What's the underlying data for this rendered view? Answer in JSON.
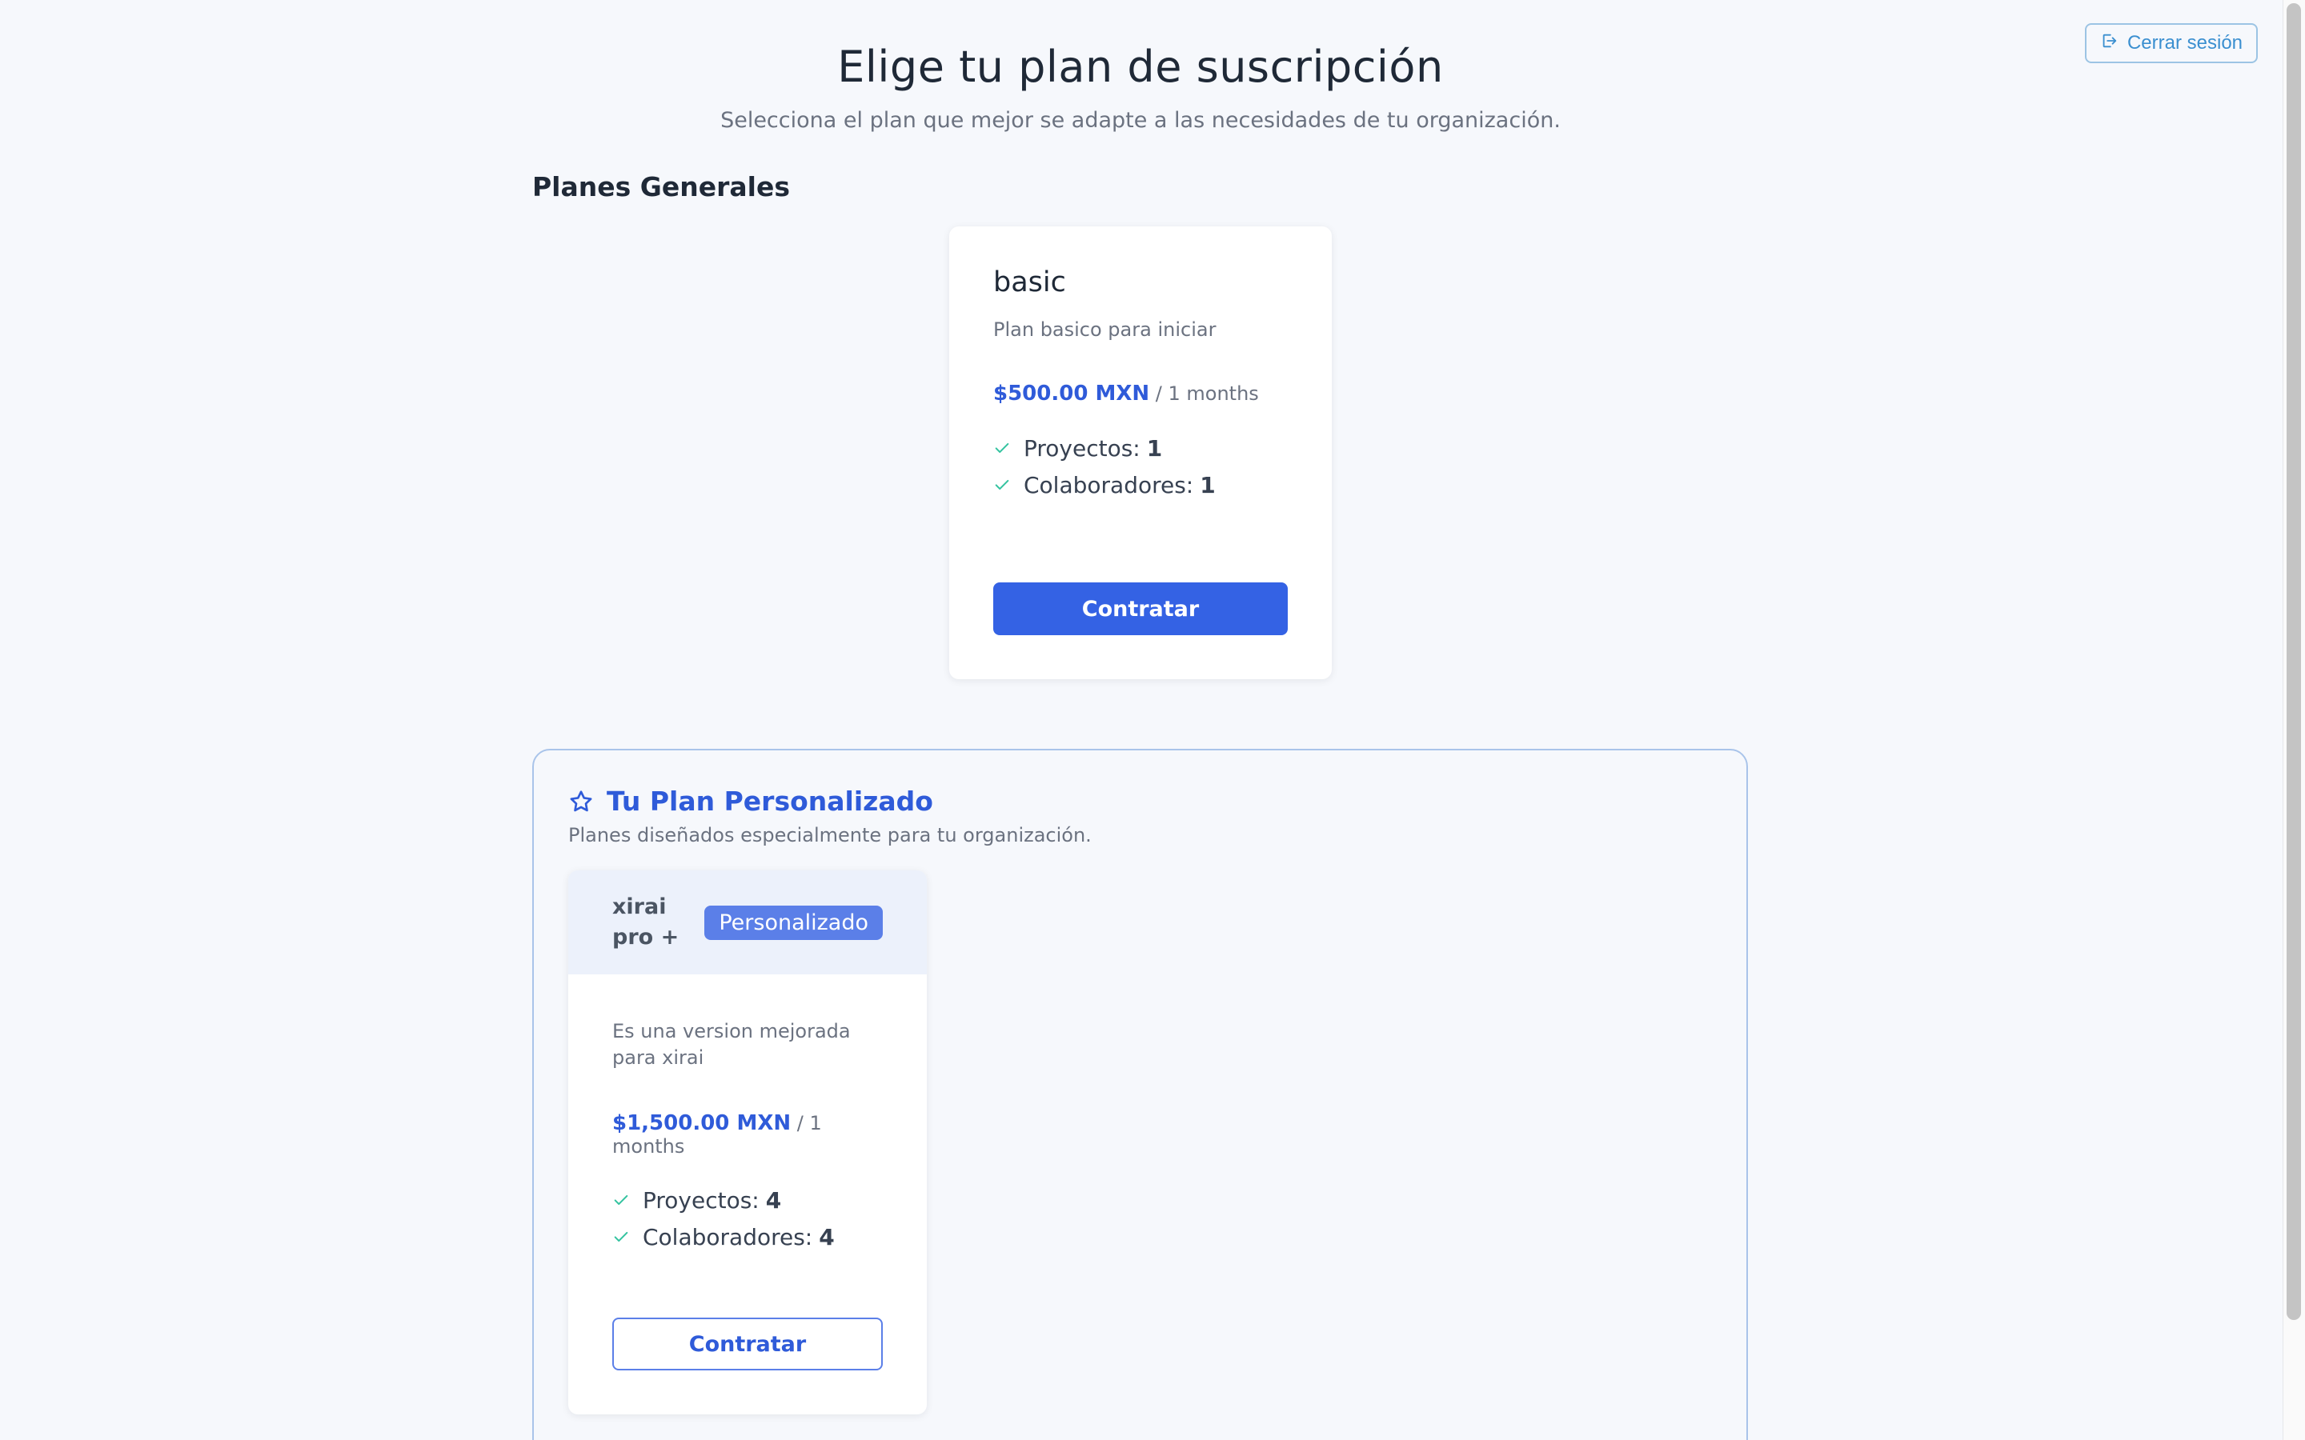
{
  "header": {
    "logout_label": "Cerrar sesión",
    "title": "Elige tu plan de suscripción",
    "subtitle": "Selecciona el plan que mejor se adapte a las necesidades de tu organización."
  },
  "general_plans": {
    "section_title": "Planes Generales",
    "plans": [
      {
        "name": "basic",
        "description": "Plan basico para iniciar",
        "price": "$500.00 MXN",
        "period": "/ 1 months",
        "features": [
          {
            "label": "Proyectos:",
            "value": "1"
          },
          {
            "label": "Colaboradores:",
            "value": "1"
          }
        ],
        "button_label": "Contratar"
      }
    ]
  },
  "custom_plans": {
    "title": "Tu Plan Personalizado",
    "description": "Planes diseñados especialmente para tu organización.",
    "plans": [
      {
        "name": "xirai pro +",
        "badge": "Personalizado",
        "description": "Es una version mejorada para xirai",
        "price": "$1,500.00 MXN",
        "period": "/ 1 months",
        "features": [
          {
            "label": "Proyectos:",
            "value": "4"
          },
          {
            "label": "Colaboradores:",
            "value": "4"
          }
        ],
        "button_label": "Contratar"
      }
    ]
  },
  "colors": {
    "accent": "#3462e4",
    "check": "#34c3a0",
    "background": "#f6f8fc"
  }
}
